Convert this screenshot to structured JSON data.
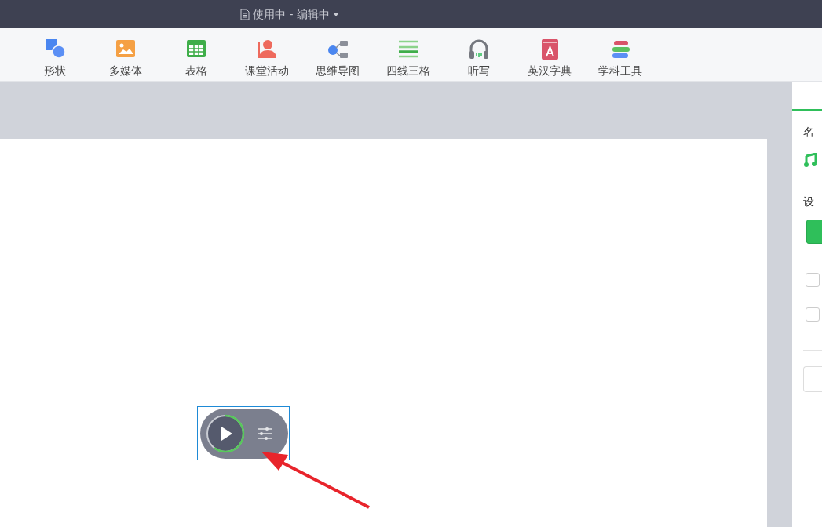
{
  "title_bar": {
    "document_status": "使用中 - 编辑中"
  },
  "toolbar": [
    {
      "label": "形状",
      "kind": "shape"
    },
    {
      "label": "多媒体",
      "kind": "media"
    },
    {
      "label": "表格",
      "kind": "table"
    },
    {
      "label": "课堂活动",
      "kind": "activity"
    },
    {
      "label": "思维导图",
      "kind": "mindmap"
    },
    {
      "label": "四线三格",
      "kind": "lines"
    },
    {
      "label": "听写",
      "kind": "dictation"
    },
    {
      "label": "英汉字典",
      "kind": "dictionary"
    },
    {
      "label": "学科工具",
      "kind": "tools"
    }
  ],
  "properties_panel": {
    "name_label": "名",
    "settings_label": "设",
    "checkboxes": [
      {
        "checked": false
      },
      {
        "checked": false
      }
    ]
  }
}
